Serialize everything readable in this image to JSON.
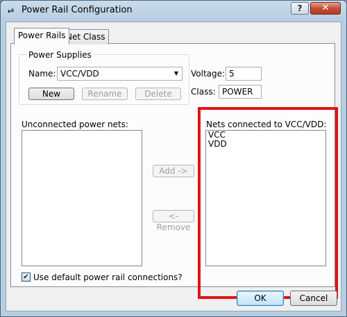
{
  "window": {
    "title": "Power Rail Configuration",
    "help_label": "?",
    "close_label": "✕",
    "app_icon": "⏯"
  },
  "tabs": [
    {
      "label": "Power Rails",
      "active": true
    },
    {
      "label": "Net Class",
      "active": false
    }
  ],
  "power_supplies": {
    "group_label": "Power Supplies",
    "name_label": "Name:",
    "name_value": "VCC/VDD",
    "voltage_label": "Voltage:",
    "voltage_value": "5",
    "class_label": "Class:",
    "class_value": "POWER",
    "new_label": "New",
    "rename_label": "Rename",
    "delete_label": "Delete"
  },
  "unconnected": {
    "label": "Unconnected power nets:",
    "items": []
  },
  "connected": {
    "label": "Nets connected to VCC/VDD:",
    "items": [
      "VCC",
      "VDD"
    ]
  },
  "actions": {
    "add_label": "Add ->",
    "remove_label": "<- Remove"
  },
  "options": {
    "use_default_label": "Use default power rail connections?",
    "use_default_checked": true,
    "check_glyph": "✔"
  },
  "footer": {
    "ok_label": "OK",
    "cancel_label": "Cancel"
  },
  "colors": {
    "highlight": "#e01414",
    "titlebar": "#b7cde0"
  }
}
